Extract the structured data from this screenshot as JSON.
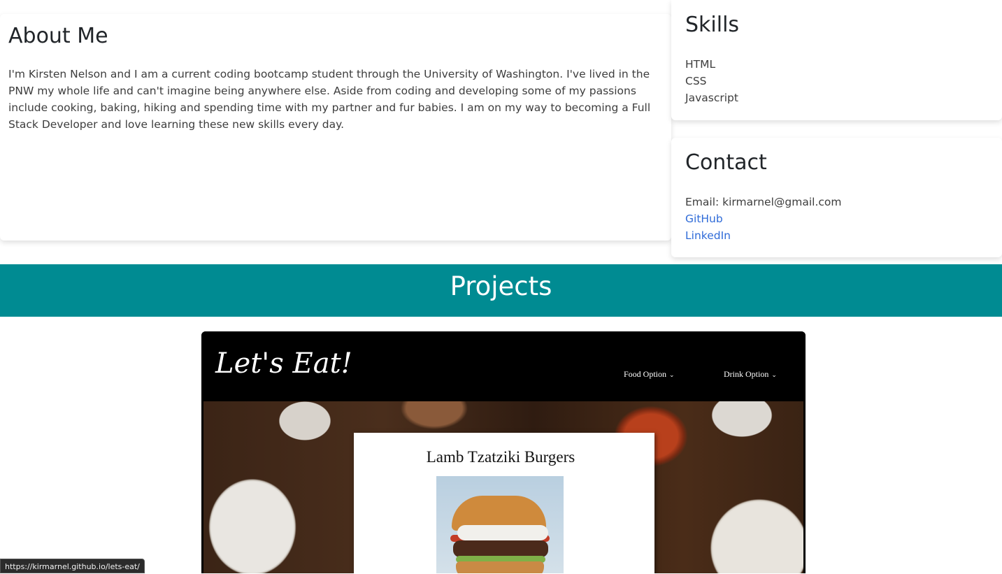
{
  "about": {
    "heading": "About Me",
    "text": "I'm Kirsten Nelson and I am a current coding bootcamp student through the University of Washington. I've lived in the PNW my whole life and can't imagine being anywhere else. Aside from coding and developing some of my passions include cooking, baking, hiking and spending time with my partner and fur babies. I am on my way to becoming a Full Stack Developer and love learning these new skills every day."
  },
  "skills": {
    "heading": "Skills",
    "items": [
      "HTML",
      "CSS",
      "Javascript"
    ]
  },
  "contact": {
    "heading": "Contact",
    "email": "Email: kirmarnel@gmail.com",
    "github": "GitHub",
    "linkedin": "LinkedIn"
  },
  "projects": {
    "heading": "Projects",
    "screenshot": {
      "logo": "Let's Eat!",
      "menu": [
        "Food Option",
        "Drink Option"
      ],
      "recipe_title": "Lamb Tzatziki Burgers"
    }
  },
  "status_bar": {
    "url": "https://kirmarnel.github.io/lets-eat/"
  },
  "colors": {
    "projects_bar": "#008b92",
    "link": "#2f6bd8"
  }
}
